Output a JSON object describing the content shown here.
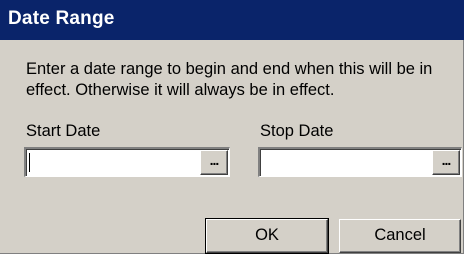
{
  "dialog": {
    "title": "Date Range",
    "description": "Enter a date range to begin and end when this will be in effect. Otherwise it will always be in effect."
  },
  "start_date": {
    "label": "Start Date",
    "value": "",
    "browse_label": "..."
  },
  "stop_date": {
    "label": "Stop Date",
    "value": "",
    "browse_label": "..."
  },
  "buttons": {
    "ok_label": "OK",
    "cancel_label": "Cancel"
  },
  "colors": {
    "titlebar": "#0a246a",
    "title_text": "#ffffff",
    "dialog_face": "#d4d0c8"
  }
}
